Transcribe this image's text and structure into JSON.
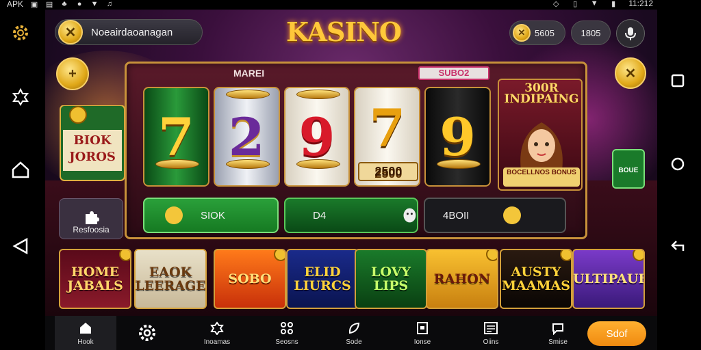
{
  "status_bar": {
    "carrier": "APK",
    "time": "11:212"
  },
  "header": {
    "account_name": "Noeairdaoanagan",
    "logo": "KASINO",
    "balance_1": "5605",
    "balance_2": "1805"
  },
  "slot": {
    "label_left": "MAREI",
    "label_right": "SUBO2",
    "reels": [
      "7",
      "2",
      "9",
      "7",
      "9"
    ],
    "prize": "2500",
    "promo_title": "300R INDIPAING",
    "promo_banner": "BOCELLNOS BONUS",
    "controls": [
      "SIOK",
      "D4",
      "4BOII"
    ]
  },
  "side": {
    "left_card": "BIOK JOROS",
    "reset_button": "Resfoosia",
    "right_green": "BOUE"
  },
  "tiles": [
    {
      "label": "HOME JABALS",
      "colors": [
        "#5a0a1a",
        "#8a1a2a"
      ],
      "text": "#ffd66a"
    },
    {
      "label": "EAOK LEERAGE",
      "colors": [
        "#e8e0c8",
        "#c8b898"
      ],
      "text": "#6a3a10"
    },
    {
      "label": "SOBO",
      "colors": [
        "#ff7a1a",
        "#c8300a"
      ],
      "text": "#ffe07a"
    },
    {
      "label": "ELID LIURCS",
      "colors": [
        "#1a2a8a",
        "#0a1450"
      ],
      "text": "#ffd23a"
    },
    {
      "label": "LOVY LIPS",
      "colors": [
        "#1a7a2a",
        "#0a4012"
      ],
      "text": "#c8ff6a"
    },
    {
      "label": "RAHON",
      "colors": [
        "#f8c030",
        "#c88010"
      ],
      "text": "#6a1a0a"
    },
    {
      "label": "AUSTY MAAMAS",
      "colors": [
        "#2a1a10",
        "#0a0604"
      ],
      "text": "#ffd23a"
    },
    {
      "label": "MULTIPAUBS",
      "colors": [
        "#7a3ac8",
        "#3a1a7a"
      ],
      "text": "#ffe07a"
    }
  ],
  "bottom_nav": {
    "items": [
      {
        "label": "Hook",
        "icon": "home-icon"
      },
      {
        "label": "",
        "icon": "settings-icon"
      },
      {
        "label": "Inoamas",
        "icon": "puzzle-icon"
      },
      {
        "label": "Seosns",
        "icon": "grid-icon"
      },
      {
        "label": "Sode",
        "icon": "leaf-icon"
      },
      {
        "label": "Ionse",
        "icon": "frame-icon"
      },
      {
        "label": "Oiins",
        "icon": "list-icon"
      },
      {
        "label": "Smise",
        "icon": "chat-icon"
      }
    ],
    "cta": "Sdof"
  },
  "colors": {
    "accent_gold": "#ffc83a",
    "cta_orange": "#f08a10",
    "control_green": "#1a8a2a"
  }
}
